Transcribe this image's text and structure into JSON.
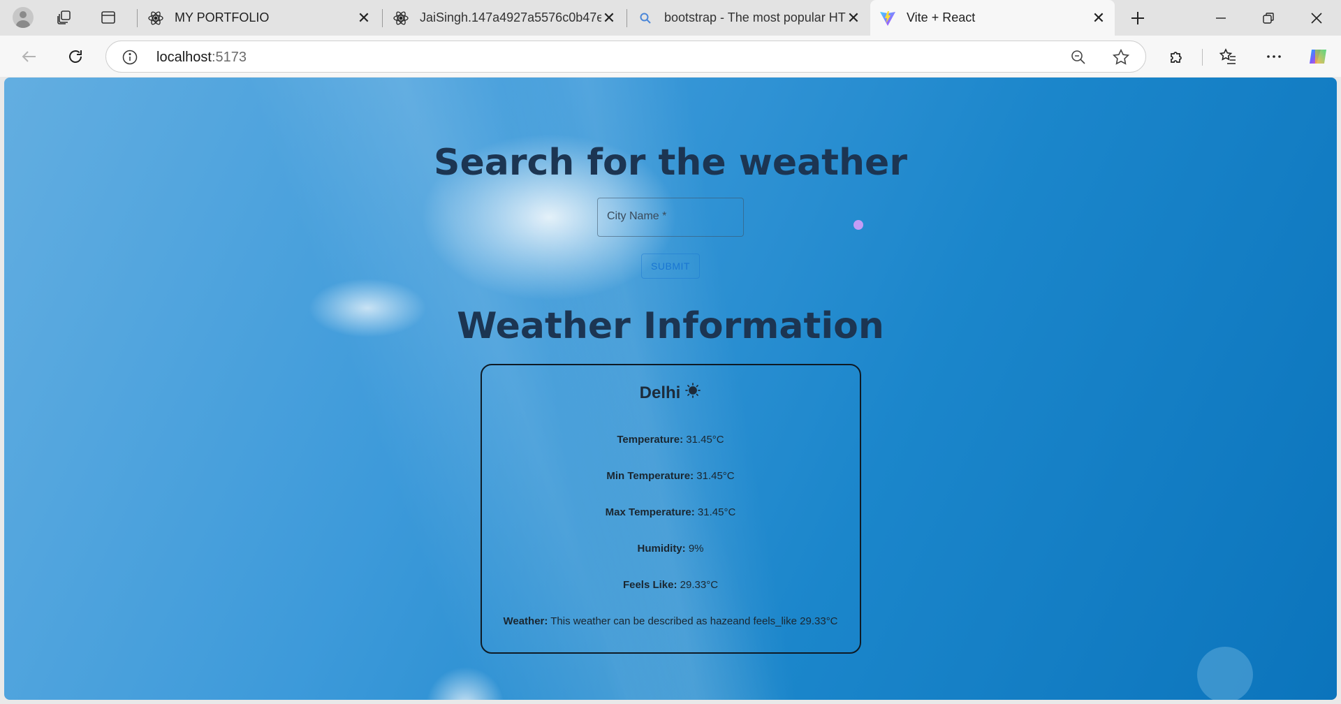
{
  "browser": {
    "tabs": [
      {
        "title": "MY PORTFOLIO",
        "icon": "react-icon",
        "active": false
      },
      {
        "title": "JaiSingh.147a4927a5576c0b47ea",
        "icon": "react-icon",
        "active": false
      },
      {
        "title": "bootstrap - The most popular HT",
        "icon": "search-icon",
        "active": false
      },
      {
        "title": "Vite + React",
        "icon": "vite-icon",
        "active": true
      }
    ],
    "url_host": "localhost",
    "url_port": ":5173"
  },
  "page": {
    "search_heading": "Search for the weather",
    "city_placeholder": "City Name *",
    "submit_label": "SUBMIT",
    "info_heading": "Weather Information",
    "city": "Delhi",
    "rows": [
      {
        "label": "Temperature:",
        "value": " 31.45°C"
      },
      {
        "label": "Min Temperature:",
        "value": " 31.45°C"
      },
      {
        "label": "Max Temperature:",
        "value": " 31.45°C"
      },
      {
        "label": "Humidity:",
        "value": " 9%"
      },
      {
        "label": "Feels Like:",
        "value": " 29.33°C"
      },
      {
        "label": "Weather:",
        "value": " This weather can be described as hazeand feels_like 29.33°C"
      }
    ]
  },
  "colors": {
    "heading": "#1c3552",
    "accent": "#1976d2",
    "card_border": "#0e1a25"
  }
}
